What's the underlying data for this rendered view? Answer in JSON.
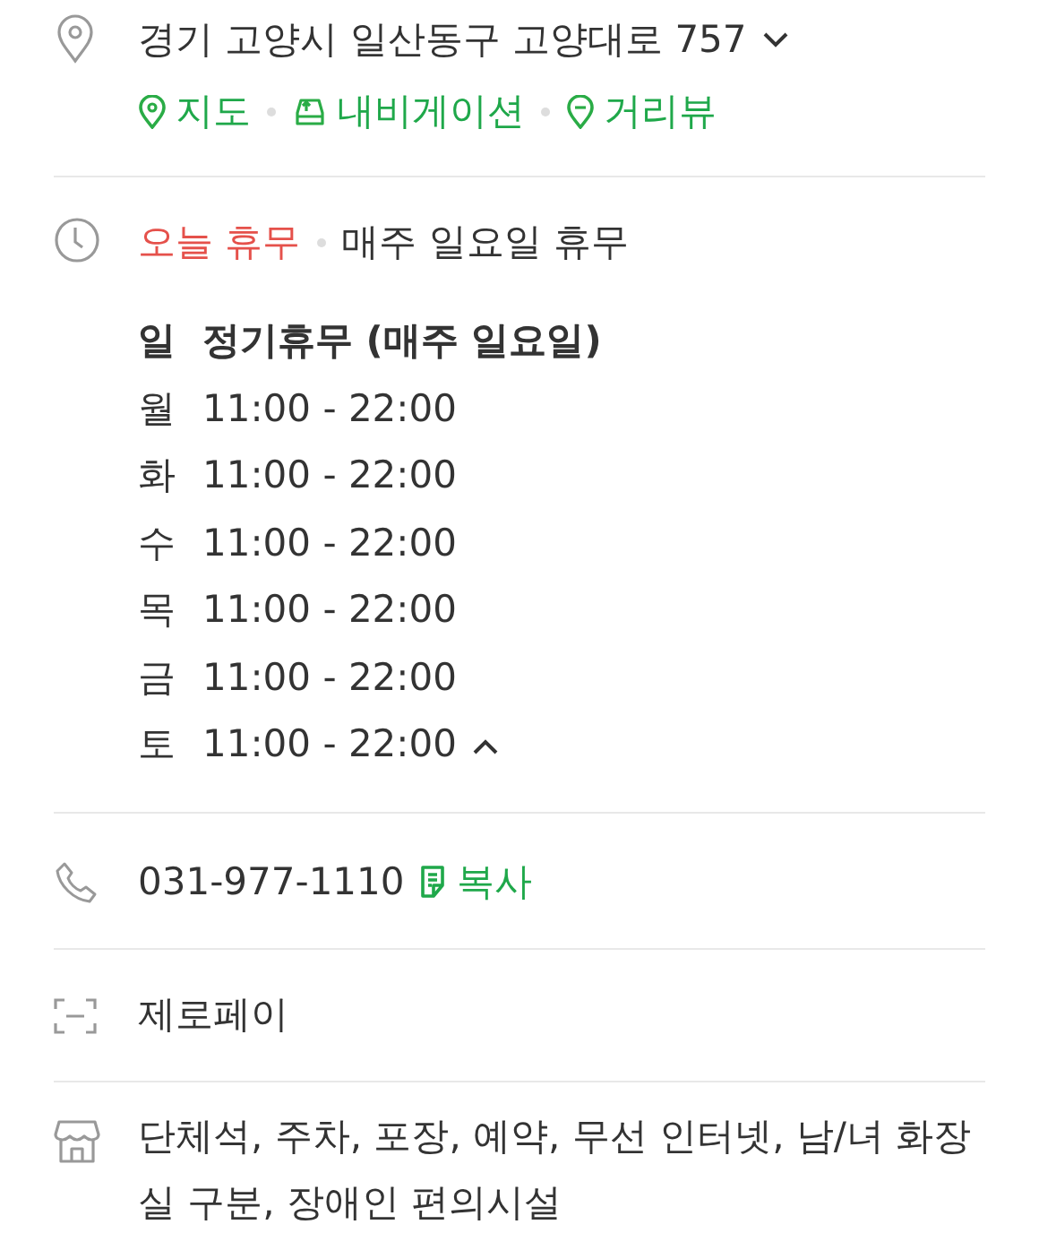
{
  "address": {
    "text": "경기 고양시 일산동구 고양대로 757",
    "expanded": false
  },
  "links": [
    {
      "kind": "map",
      "label": "지도"
    },
    {
      "kind": "navigation",
      "label": "내비게이션"
    },
    {
      "kind": "streetview",
      "label": "거리뷰"
    }
  ],
  "hours": {
    "status": "오늘 휴무",
    "note": "매주 일요일 휴무",
    "expanded": true,
    "days": [
      {
        "day": "일",
        "time": "정기휴무 (매주 일요일)",
        "selected": true
      },
      {
        "day": "월",
        "time": "11:00 - 22:00",
        "selected": false
      },
      {
        "day": "화",
        "time": "11:00 - 22:00",
        "selected": false
      },
      {
        "day": "수",
        "time": "11:00 - 22:00",
        "selected": false
      },
      {
        "day": "목",
        "time": "11:00 - 22:00",
        "selected": false
      },
      {
        "day": "금",
        "time": "11:00 - 22:00",
        "selected": false
      },
      {
        "day": "토",
        "time": "11:00 - 22:00",
        "selected": false
      }
    ]
  },
  "phone": {
    "number": "031-977-1110",
    "copy_label": "복사"
  },
  "payment": "제로페이",
  "facilities": "단체석, 주차, 포장, 예약, 무선 인터넷, 남/녀 화장실 구분, 장애인 편의시설"
}
